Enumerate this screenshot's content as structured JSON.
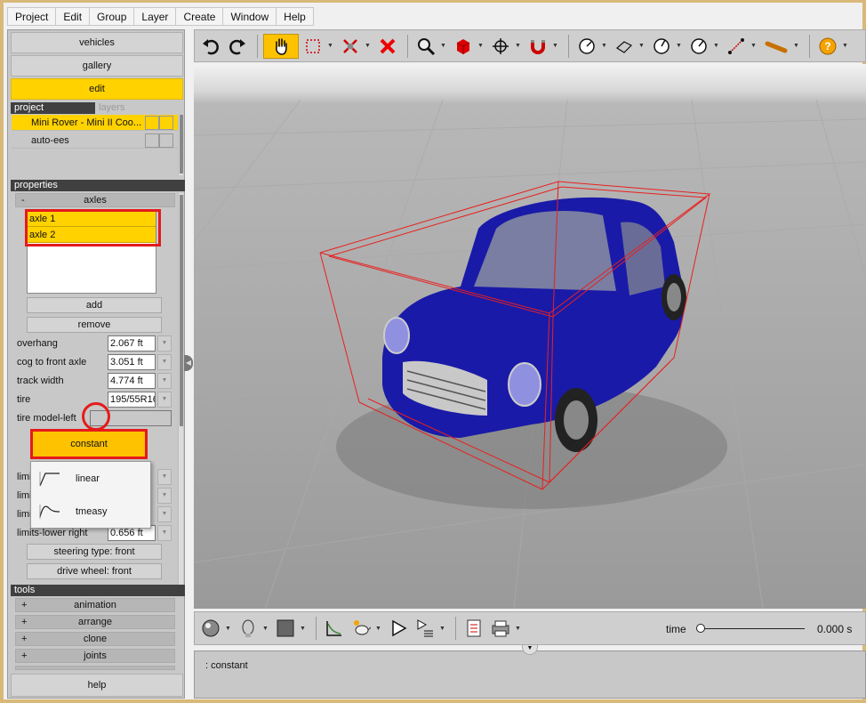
{
  "menu": [
    "Project",
    "Edit",
    "Group",
    "Layer",
    "Create",
    "Window",
    "Help"
  ],
  "nav": {
    "vehicles": "vehicles",
    "gallery": "gallery",
    "edit": "edit"
  },
  "project": {
    "tab_project": "project",
    "tab_layers": "layers",
    "rows": [
      "Mini Rover - Mini II Coo...",
      "auto-ees"
    ]
  },
  "properties": {
    "header": "properties",
    "axles_header": "axles",
    "axles_collapse": "-",
    "axles": [
      "axle 1",
      "axle 2"
    ],
    "add": "add",
    "remove": "remove",
    "fields": [
      {
        "label": "overhang",
        "value": "2.067 ft"
      },
      {
        "label": "cog to front axle",
        "value": "3.051 ft"
      },
      {
        "label": "track width",
        "value": "4.774 ft"
      },
      {
        "label": "tire",
        "value": "195/55R16"
      },
      {
        "label": "tire model-left",
        "value": ""
      }
    ],
    "hidden_limits": [
      "limi",
      "limi",
      "limi"
    ],
    "limits_lower_right": {
      "label": "limits-lower right",
      "value": "0.656 ft"
    },
    "steering_type": "steering type: front",
    "drive_wheel": "drive wheel: front"
  },
  "dropdown": {
    "selected": "constant",
    "options": [
      {
        "label": "linear",
        "icon": "linear-curve-icon"
      },
      {
        "label": "tmeasy",
        "icon": "tmeasy-curve-icon"
      }
    ]
  },
  "tools": {
    "header": "tools",
    "items": [
      "animation",
      "arrange",
      "clone",
      "joints"
    ],
    "plus": "+"
  },
  "help": "help",
  "timeline": {
    "label": "time",
    "value": "0.000 s",
    "position": 0
  },
  "console": {
    "text": ": constant"
  },
  "colors": {
    "accent": "#ffd200",
    "highlight": "#e41b1b",
    "car": "#1a1aa8"
  }
}
